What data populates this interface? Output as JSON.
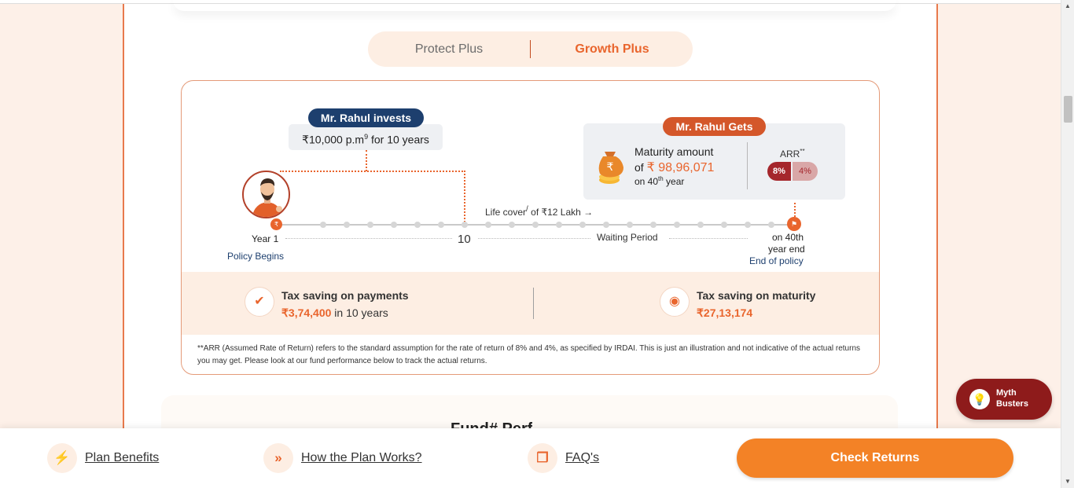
{
  "colors": {
    "accent": "#e9652d",
    "navy": "#1d3f6e",
    "maroon": "#a5272c",
    "myth_bg": "#8e1b1b",
    "cta": "#f38226",
    "soft_bg": "#fdeee3"
  },
  "tabs": [
    {
      "label": "Protect Plus",
      "active": false
    },
    {
      "label": "Growth Plus",
      "active": true
    }
  ],
  "illustration": {
    "invest_pill": "Mr. Rahul invests",
    "invest_amount": "₹10,000 p.m",
    "invest_sup": "9",
    "invest_duration": " for 10 years",
    "gets_pill": "Mr. Rahul Gets",
    "maturity_line1": "Maturity amount",
    "maturity_of": "of ",
    "maturity_amount": "₹ 98,96,071",
    "maturity_on": "on 40",
    "maturity_sup": "th",
    "maturity_year": " year",
    "arr_label": "ARR",
    "arr_sup": "**",
    "arr_high": "8%",
    "arr_low": "4%",
    "life_cover": "Life cover",
    "life_cover_mark": "/",
    "life_cover_value": " of ₹12 Lakh →",
    "year_start": "Year 1",
    "policy_begins": "Policy Begins",
    "year_mid": "10",
    "waiting_period": "Waiting Period",
    "end_line1": "on 40th",
    "end_line2": "year end",
    "end_of_policy": "End of policy"
  },
  "tax": {
    "payments_title": "Tax saving on payments",
    "payments_value": "₹3,74,400",
    "payments_suffix": " in 10 years",
    "maturity_title": "Tax saving on maturity",
    "maturity_value": "₹27,13,174"
  },
  "disclaimer": "**ARR (Assumed Rate of Return) refers to the standard assumption for the rate of return of 8% and 4%, as specified by IRDAI. This is just an illustration and not indicative of the actual returns you may get. Please look at our fund performance below to track the actual returns.",
  "next_section_title": "Fund# Perf",
  "myth_busters": {
    "line1": "Myth",
    "line2": "Busters"
  },
  "bottom_nav": {
    "plan_benefits": "Plan Benefits",
    "how_plan_works": "How the Plan Works?",
    "faqs": "FAQ's",
    "check_returns": "Check Returns"
  },
  "icons": [
    "rupee-icon",
    "flag-icon",
    "money-bag-icon",
    "badge-check-icon",
    "coins-icon",
    "bulb-icon",
    "lightning-icon",
    "double-chevron-icon",
    "chat-icon"
  ]
}
